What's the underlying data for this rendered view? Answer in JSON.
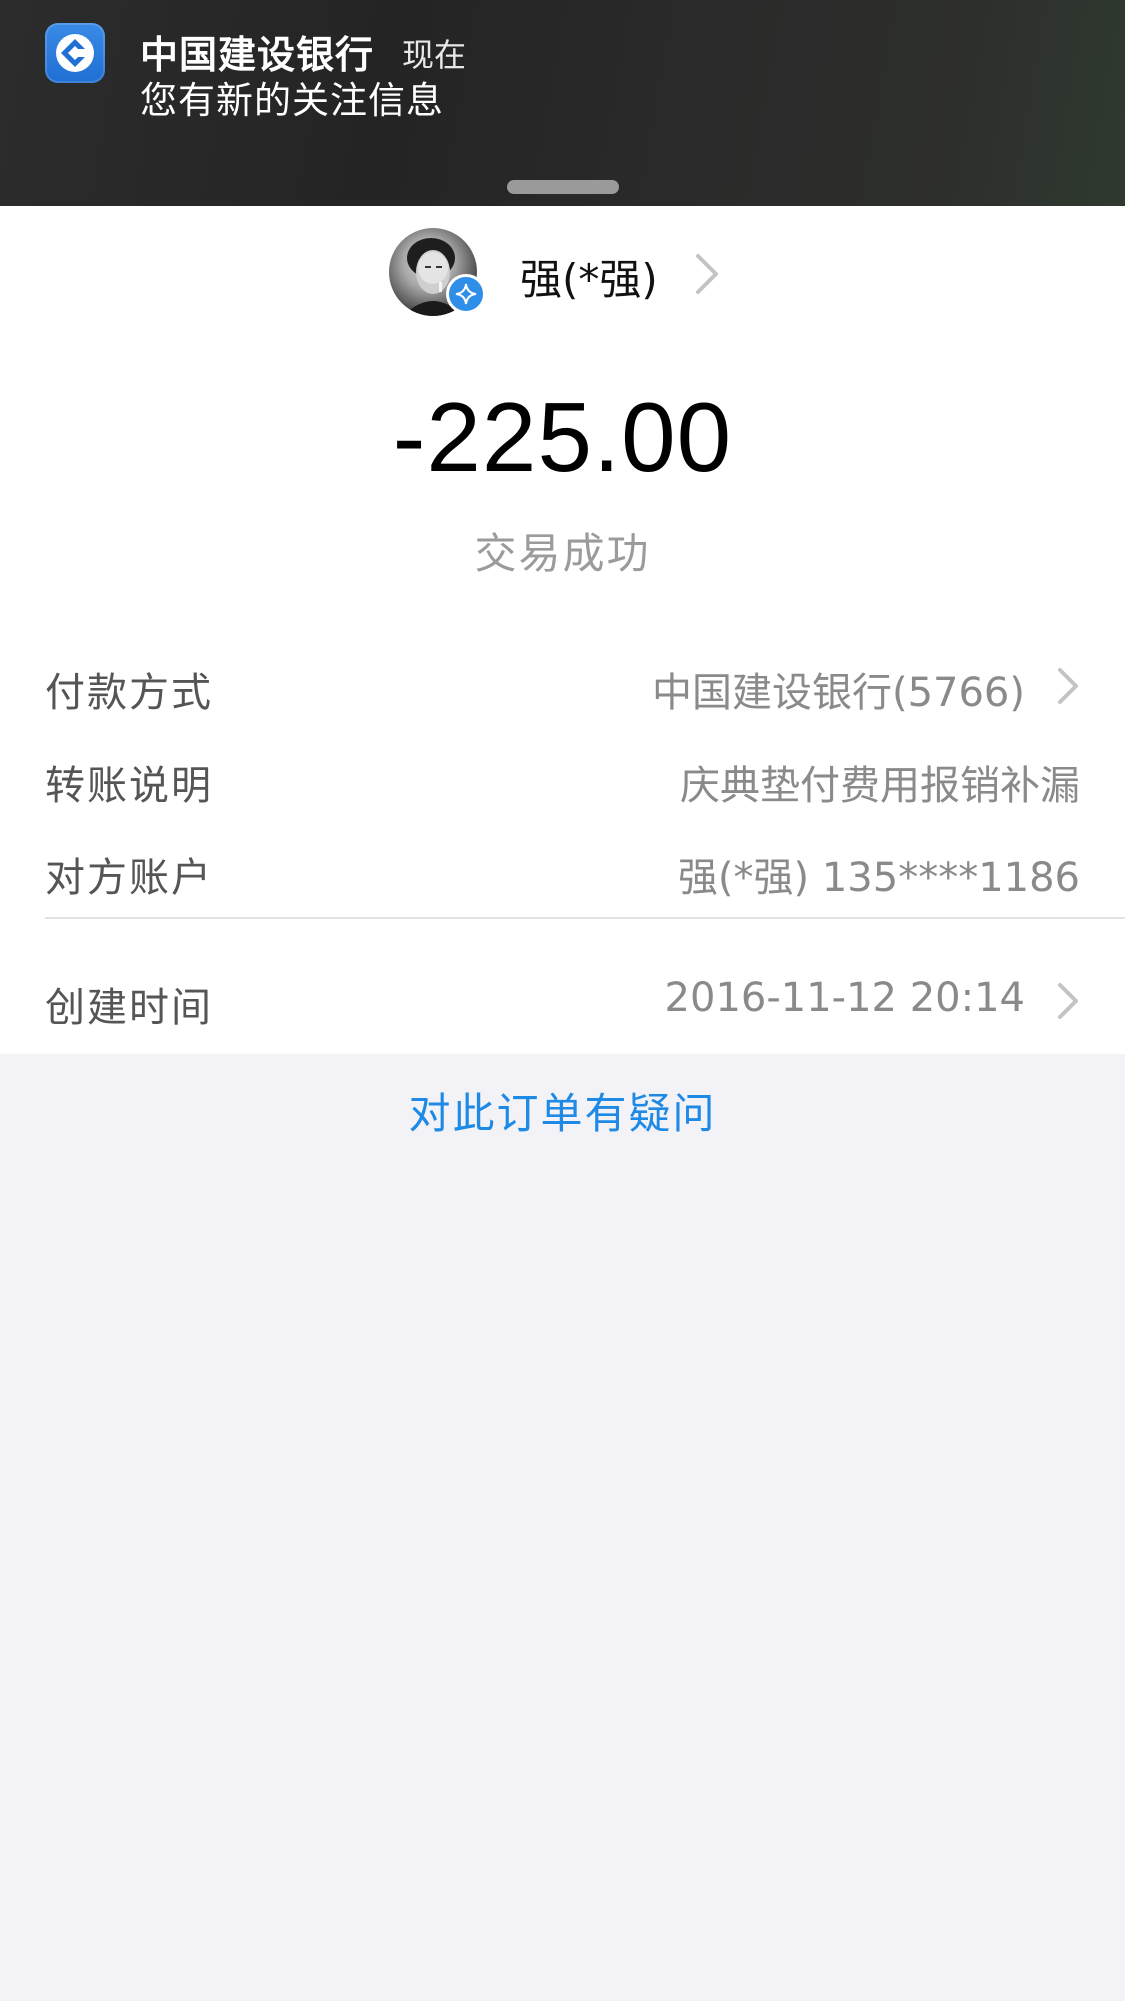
{
  "notification": {
    "app_name": "中国建设银行",
    "time": "现在",
    "message": "您有新的关注信息",
    "icon": "ccb-bank-logo-icon"
  },
  "payee": {
    "name": "强(*强)",
    "avatar": "user-avatar",
    "badge_icon": "verified-badge-icon"
  },
  "transaction": {
    "amount": "-225.00",
    "status": "交易成功"
  },
  "details": [
    {
      "label": "付款方式",
      "value": "中国建设银行(5766)",
      "has_chevron": true
    },
    {
      "label": "转账说明",
      "value": "庆典垫付费用报销补漏",
      "has_chevron": false
    },
    {
      "label": "对方账户",
      "value": "强(*强) 135****1186",
      "has_chevron": false
    },
    {
      "label": "创建时间",
      "value": "2016-11-12 20:14",
      "has_chevron": true
    }
  ],
  "footer": {
    "question_link": "对此订单有疑问"
  },
  "colors": {
    "link_blue": "#1e8ae6",
    "badge_blue": "#2f8fe8",
    "page_background": "#f2f2f7"
  }
}
